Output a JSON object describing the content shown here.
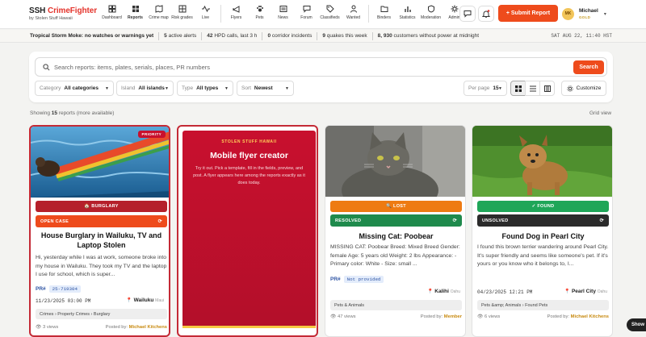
{
  "brand": {
    "title_a": "SSH ",
    "title_b": "CrimeFighter",
    "subtitle": "by Stolen Stuff Hawaii"
  },
  "nav": [
    {
      "label": "Dashboard",
      "icon": "dashboard-icon"
    },
    {
      "label": "Reports",
      "icon": "reports-icon",
      "active": true
    },
    {
      "label": "Crime map",
      "icon": "map-icon"
    },
    {
      "label": "Risk grades",
      "icon": "grid-icon"
    },
    {
      "label": "Live",
      "icon": "live-icon"
    },
    {
      "label": "Flyers",
      "icon": "flyer-icon"
    },
    {
      "label": "Pets",
      "icon": "paw-icon"
    },
    {
      "label": "News",
      "icon": "news-icon"
    },
    {
      "label": "Forum",
      "icon": "forum-icon"
    },
    {
      "label": "Classifieds",
      "icon": "tag-icon"
    },
    {
      "label": "Wanted",
      "icon": "user-icon"
    },
    {
      "label": "Binders",
      "icon": "folder-icon"
    },
    {
      "label": "Statistics",
      "icon": "chart-icon"
    },
    {
      "label": "Moderation",
      "icon": "shield-icon"
    },
    {
      "label": "Admin",
      "icon": "gear-icon"
    }
  ],
  "header": {
    "submit_label": "+ Submit Report",
    "user_name": "Michael",
    "user_initials": "MK",
    "user_tier": "GOLD"
  },
  "alerts": {
    "storm": "Tropical Storm Moke: no watches or warnings yet",
    "active": "5",
    "active_lbl": " active alerts",
    "hpd": "42",
    "hpd_lbl": " HPD calls, last 3 h",
    "corridor": "0",
    "corridor_lbl": " corridor incidents",
    "quakes": "9",
    "quakes_lbl": " quakes this week",
    "power": "8, 930",
    "power_lbl": " customers without power at midnight",
    "clock": "SAT AUG 22, 11:40 HST"
  },
  "filters": {
    "search_placeholder": "Search reports: items, plates, serials, places, PR numbers",
    "search_btn": "Search",
    "category_lbl": "Category",
    "category_val": "All categories",
    "island_lbl": "Island",
    "island_val": "All islands",
    "type_lbl": "Type",
    "type_val": "All types",
    "sort_lbl": "Sort",
    "sort_val": "Newest",
    "perpage_lbl": "Per page",
    "perpage_val": "15",
    "customize": "Customize"
  },
  "results": {
    "prefix": "Showing ",
    "count": "15",
    "suffix": " reports (more available)",
    "view": "Grid view"
  },
  "cards": [
    {
      "priority": "PRIORITY",
      "category": "🏠 BURGLARY",
      "status": "OPEN CASE",
      "title": "House Burglary in Wailuku, TV and Laptop Stolen",
      "body": "Hi, yesterday while I was at work, someone broke into my house in Wailuku. They took my TV and the laptop I use for school, which is super...",
      "pr_lbl": "PR#",
      "pr": "25-719304",
      "date": "11/23/2025  03:00 PM",
      "loc": "Wailuku",
      "island": "Maui",
      "tags": "Crimes › Property Crimes › Burglary",
      "views": "3 views",
      "by": "Posted by: ",
      "author": "Michael Kitchens"
    },
    {
      "kicker": "STOLEN STUFF HAWAII",
      "title": "Mobile flyer creator",
      "desc": "Try it out. Pick a template, fill in the fields, preview, and post. A flyer appears here among the reports exactly as it does today."
    },
    {
      "category": "🔍 LOST",
      "status": "RESOLVED",
      "title": "Missing Cat: Poobear",
      "body": "MISSING CAT: Poobear Breed: Mixed Breed Gender: female Age: 5 years old Weight: 2 lbs Appearance: - Primary color: White - Size: small ...",
      "pr_lbl": "PR#",
      "pr": "Not provided",
      "loc": "Kalihi",
      "island": "Oahu",
      "tags": "Pets & Animals",
      "views": "47 views",
      "by": "Posted by: ",
      "author": "Member"
    },
    {
      "category": "✓ FOUND",
      "status": "UNSOLVED",
      "title": "Found Dog in Pearl City",
      "body": "I found this brown terrier wandering around Pearl City. It's super friendly and seems like someone's pet. If it's yours or you know who it belongs to, I...",
      "date": "04/23/2025  12:21 PM",
      "loc": "Pearl City",
      "island": "Oahu",
      "tags": "Pets &amp; Animals › Found Pets",
      "views": "6 views",
      "by": "Posted by: ",
      "author": "Michael Kitchens"
    }
  ],
  "show_me": "Show"
}
